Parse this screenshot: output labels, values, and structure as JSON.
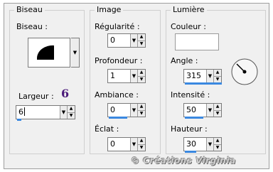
{
  "biseau": {
    "title": "Biseau",
    "bevel_label": "Biseau :",
    "largeur_label": "Largeur :",
    "largeur_annotation": "6",
    "largeur_value": "6"
  },
  "image": {
    "title": "Image",
    "regularite_label": "Régularité :",
    "regularite_value": "0",
    "profondeur_label": "Profondeur :",
    "profondeur_value": "1",
    "ambiance_label": "Ambiance :",
    "ambiance_value": "0",
    "eclat_label": "Éclat :",
    "eclat_value": "0"
  },
  "lumiere": {
    "title": "Lumière",
    "couleur_label": "Couleur :",
    "couleur_hex": "#ffffff",
    "angle_label": "Angle :",
    "angle_value": "315",
    "intensite_label": "Intensité :",
    "intensite_value": "50",
    "hauteur_label": "Hauteur :",
    "hauteur_value": "30"
  },
  "watermark": "© Créations Virginia",
  "colors": {
    "accent": "#3a88e0",
    "annotation": "#4b1a7a"
  }
}
